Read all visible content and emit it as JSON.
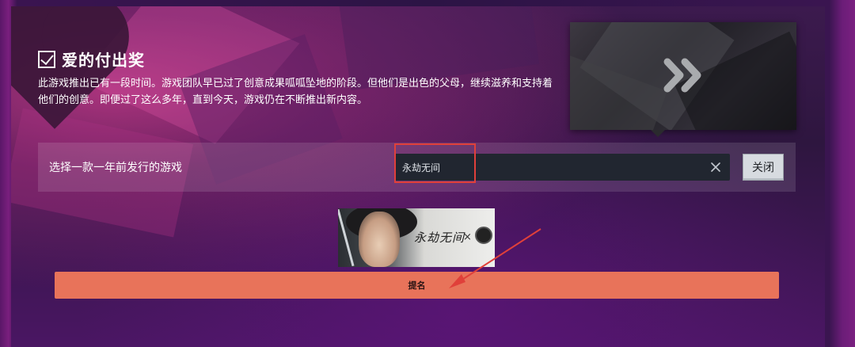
{
  "award": {
    "title": "爱的付出奖",
    "description": "此游戏推出已有一段时间。游戏团队早已过了创意成果呱呱坠地的阶段。但他们是出色的父母，继续滋养和支持着他们的创意。即便过了这么多年，直到今天，游戏仍在不断推出新内容。",
    "checked": true
  },
  "selector": {
    "label": "选择一款一年前发行的游戏",
    "search_value": "永劫无间",
    "clear_icon": "close-icon",
    "close_label": "关闭"
  },
  "game_capsule": {
    "logo_text": "永劫无间",
    "collab_mark": "×"
  },
  "nominate_label": "提名",
  "colors": {
    "accent_button": "#e8735a",
    "annotation_red": "#e0403a",
    "search_bg": "#212630"
  }
}
